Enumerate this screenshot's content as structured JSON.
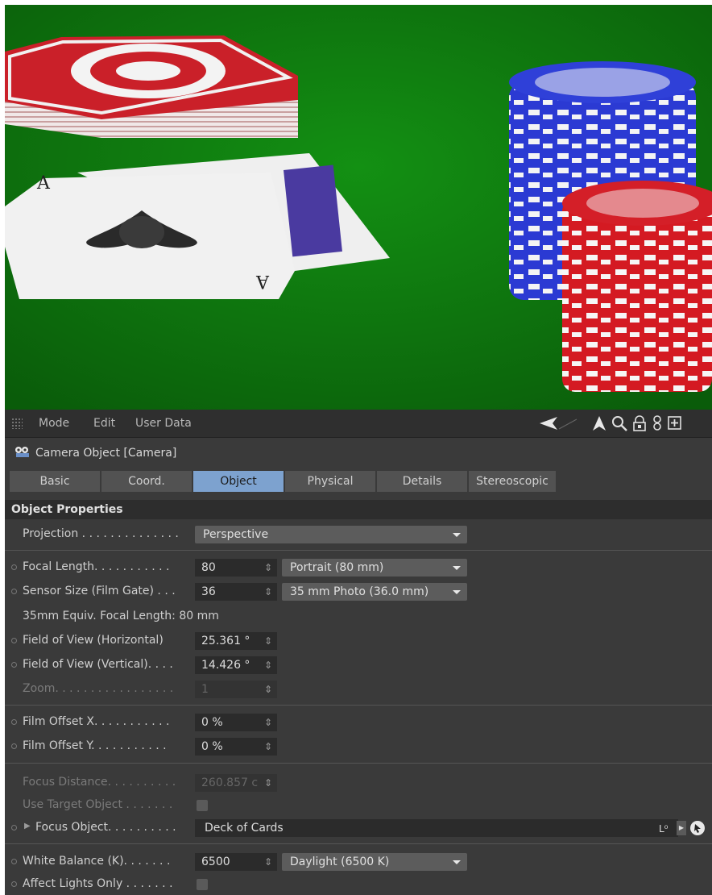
{
  "menubar": {
    "items": [
      "Mode",
      "Edit",
      "User Data"
    ],
    "icons": [
      "back-arrow-icon",
      "up-arrow-icon",
      "search-icon",
      "lock-icon",
      "link-icon",
      "new-window-icon"
    ]
  },
  "title": "Camera Object [Camera]",
  "tabs": [
    {
      "label": "Basic",
      "active": false
    },
    {
      "label": "Coord.",
      "active": false
    },
    {
      "label": "Object",
      "active": true
    },
    {
      "label": "Physical",
      "active": false
    },
    {
      "label": "Details",
      "active": false
    },
    {
      "label": "Stereoscopic",
      "active": false
    }
  ],
  "section_title": "Object Properties",
  "fields": {
    "projection": {
      "label": "Projection . . . . . . . . . . . . . .",
      "value": "Perspective"
    },
    "focal_length": {
      "label": "Focal Length. . . . . . . . . . .",
      "value": "80",
      "preset": "Portrait (80 mm)"
    },
    "sensor_size": {
      "label": "Sensor Size (Film Gate) . . .",
      "value": "36",
      "preset": "35 mm Photo (36.0 mm)"
    },
    "equiv_focal": {
      "label": "35mm Equiv. Focal Length: 80 mm"
    },
    "fov_h": {
      "label": "Field of View (Horizontal)",
      "value": "25.361 °"
    },
    "fov_v": {
      "label": "Field of View (Vertical). . . .",
      "value": "14.426 °"
    },
    "zoom": {
      "label": "Zoom. . . . . . . . . . . . . . . . .",
      "value": "1"
    },
    "film_offset_x": {
      "label": "Film Offset X. . . . . . . . . . .",
      "value": "0 %"
    },
    "film_offset_y": {
      "label": "Film Offset Y. . . . . . . . . . .",
      "value": "0 %"
    },
    "focus_distance": {
      "label": "Focus Distance. . . . . . . . . .",
      "value": "260.857 c"
    },
    "use_target": {
      "label": "Use Target Object . . . . . . ."
    },
    "focus_object": {
      "label": "Focus Object. . . . . . . . . .",
      "value": "Deck of Cards"
    },
    "white_balance": {
      "label": "White Balance (K). . . . . . .",
      "value": "6500",
      "preset": "Daylight (6500 K)"
    },
    "affect_lights": {
      "label": "Affect Lights Only . . . . . . ."
    }
  },
  "colors": {
    "felt": "#0f7a0f",
    "active_tab": "#7da2cf",
    "panel_bg": "#3a3a3a",
    "card_back_red": "#c8202a",
    "chip_blue": "#2a3ad0",
    "chip_red": "#d11a22"
  }
}
